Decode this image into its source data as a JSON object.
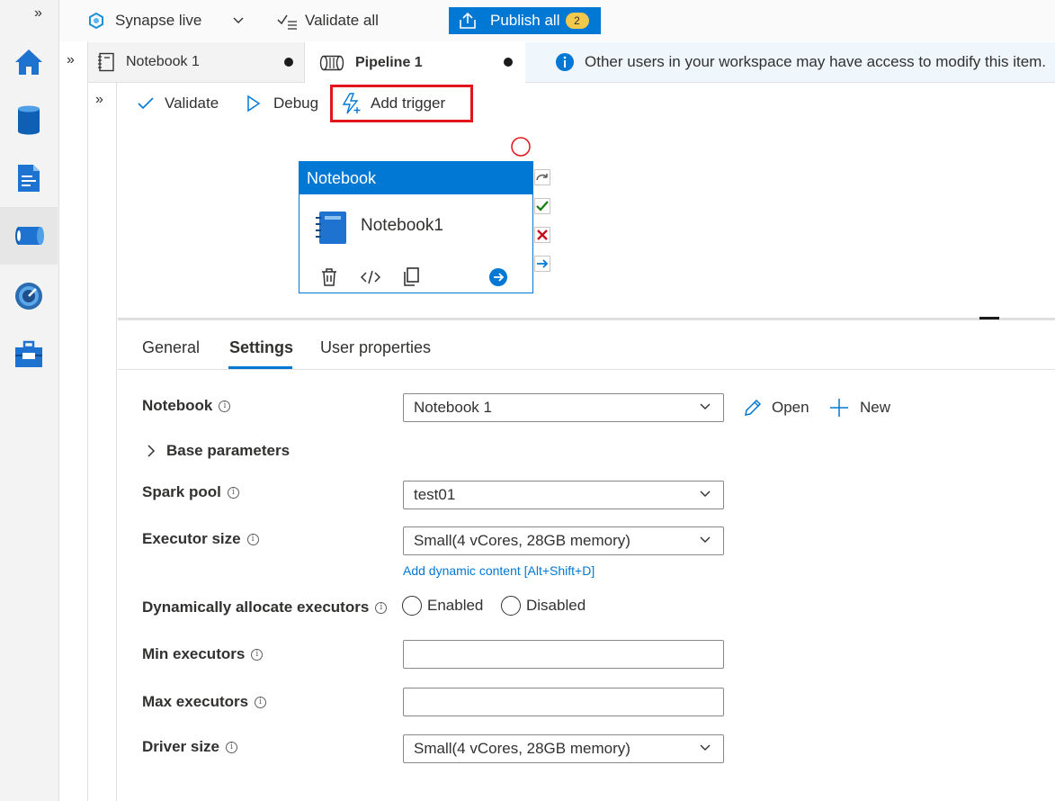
{
  "rail": {
    "expand_glyph": "»",
    "items": [
      {
        "name": "home-icon"
      },
      {
        "name": "data-icon"
      },
      {
        "name": "develop-icon"
      },
      {
        "name": "integrate-icon"
      },
      {
        "name": "monitor-icon"
      },
      {
        "name": "manage-icon"
      }
    ]
  },
  "topbar": {
    "workspace": "Synapse live",
    "validate_all": "Validate all",
    "publish_all": "Publish all",
    "publish_count": "2"
  },
  "tabs": {
    "notebook": "Notebook 1",
    "pipeline": "Pipeline 1",
    "expand_glyph": "»"
  },
  "infobar": {
    "message": "Other users in your workspace may have access to modify this item."
  },
  "pipeline_toolbar": {
    "expand_glyph": "»",
    "validate": "Validate",
    "debug": "Debug",
    "add_trigger": "Add trigger"
  },
  "activity": {
    "type": "Notebook",
    "name": "Notebook1"
  },
  "properties": {
    "tabs": [
      "General",
      "Settings",
      "User properties"
    ],
    "active_tab": "Settings"
  },
  "form": {
    "notebook_label": "Notebook",
    "notebook_value": "Notebook 1",
    "open": "Open",
    "new": "New",
    "base_parameters": "Base parameters",
    "spark_pool_label": "Spark pool",
    "spark_pool_value": "test01",
    "executor_size_label": "Executor size",
    "executor_size_value": "Small(4 vCores, 28GB memory)",
    "dynamic_content_link": "Add dynamic content [Alt+Shift+D]",
    "dynamic_alloc_label": "Dynamically allocate executors",
    "enabled": "Enabled",
    "disabled": "Disabled",
    "min_executors_label": "Min executors",
    "min_executors_value": "",
    "max_executors_label": "Max executors",
    "max_executors_value": "",
    "driver_size_label": "Driver size",
    "driver_size_value": "Small(4 vCores, 28GB memory)"
  },
  "colors": {
    "accent": "#0078d4",
    "highlight": "#e0161c",
    "success": "#107c10",
    "error": "#c50f1f"
  }
}
